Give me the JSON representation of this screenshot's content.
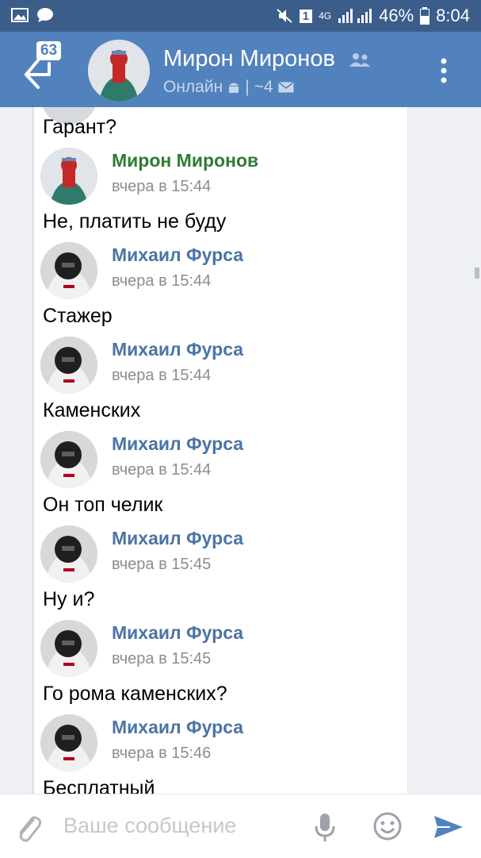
{
  "status_bar": {
    "battery": "46%",
    "time": "8:04",
    "sim": "1",
    "network": "4G"
  },
  "header": {
    "unread_count": "63",
    "title": "Мирон Миронов",
    "status": "Онлайн",
    "separator": "|",
    "members": "~4"
  },
  "chat": {
    "top_partial_text": "Гарант?",
    "messages": [
      {
        "author": "Мирон Миронов",
        "time": "вчера в 15:44",
        "text": "Не, платить не буду",
        "author_color": "#2e7d32"
      },
      {
        "author": "Михаил Фурса",
        "time": "вчера в 15:44",
        "text": "Стажер",
        "author_color": "#4b74a5"
      },
      {
        "author": "Михаил Фурса",
        "time": "вчера в 15:44",
        "text": "Каменских",
        "author_color": "#4b74a5"
      },
      {
        "author": "Михаил Фурса",
        "time": "вчера в 15:44",
        "text": "Он топ челик",
        "author_color": "#4b74a5"
      },
      {
        "author": "Михаил Фурса",
        "time": "вчера в 15:45",
        "text": "Ну и?",
        "author_color": "#4b74a5"
      },
      {
        "author": "Михаил Фурса",
        "time": "вчера в 15:45",
        "text": "Го рома каменских?",
        "author_color": "#4b74a5"
      },
      {
        "author": "Михаил Фурса",
        "time": "вчера в 15:46",
        "text": "Бесплатный",
        "author_color": "#4b74a5"
      }
    ]
  },
  "input": {
    "placeholder": "Ваше сообщение"
  },
  "icons": {
    "status_bar": [
      "gallery-icon",
      "message-icon",
      "mute-icon",
      "signal-icon",
      "battery-icon"
    ],
    "header": [
      "back-arrow-icon",
      "group-icon",
      "android-icon",
      "mail-icon",
      "more-icon"
    ],
    "input": [
      "attach-icon",
      "microphone-icon",
      "smile-icon",
      "send-icon"
    ]
  }
}
